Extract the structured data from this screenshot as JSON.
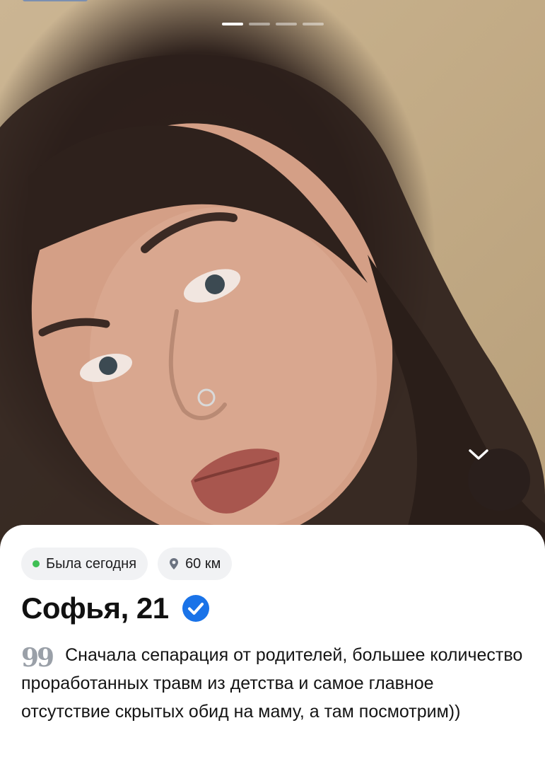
{
  "photo": {
    "pager_total": 4,
    "pager_active": 1
  },
  "status_chips": {
    "online_text": "Была сегодня",
    "online_color": "#3fbf54",
    "distance_text": "60 км"
  },
  "profile": {
    "name_age": "Софья, 21",
    "verified": true,
    "quote_glyph": "99",
    "bio": "Сначала сепарация от родителей, большее количество проработанных травм из детства и самое главное отсутствие скрытых обид на маму, а там посмотрим))"
  },
  "colors": {
    "verified_badge": "#1a73e8",
    "expand_button": "#2a1f1c"
  },
  "icons": {
    "expand": "chevron-down-icon",
    "distance": "location-pin-icon",
    "verified": "verified-check-icon"
  }
}
